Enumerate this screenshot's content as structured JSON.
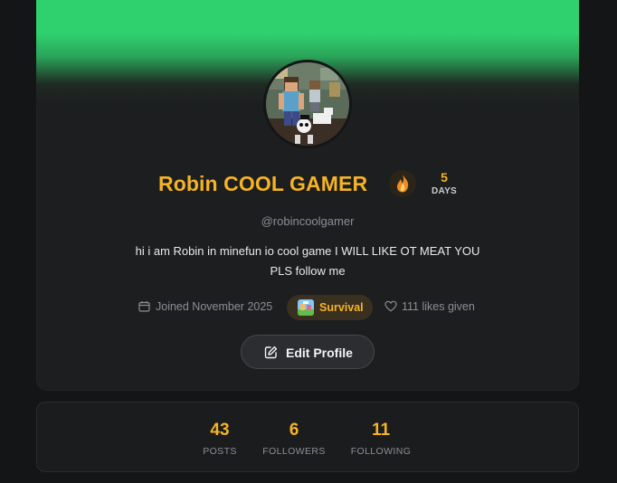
{
  "profile": {
    "display_name": "Robin COOL GAMER",
    "username": "@robincoolgamer",
    "bio": "hi i am  Robin in minefun io  cool game I WILL LIKE OT MEAT YOU PLS follow me",
    "avatar_icon": "minecraft-characters-avatar"
  },
  "streak": {
    "count": "5",
    "unit": "DAYS",
    "icon": "fire-icon"
  },
  "meta": {
    "joined": "Joined November 2025",
    "mode": "Survival",
    "likes": "111 likes given"
  },
  "actions": {
    "edit_profile": "Edit Profile"
  },
  "stats": [
    {
      "value": "43",
      "label": "POSTS"
    },
    {
      "value": "6",
      "label": "FOLLOWERS"
    },
    {
      "value": "11",
      "label": "FOLLOWING"
    }
  ],
  "colors": {
    "accent": "#f5b325",
    "banner": "#2fd16f",
    "background": "#141516",
    "card": "#1d1e20"
  }
}
